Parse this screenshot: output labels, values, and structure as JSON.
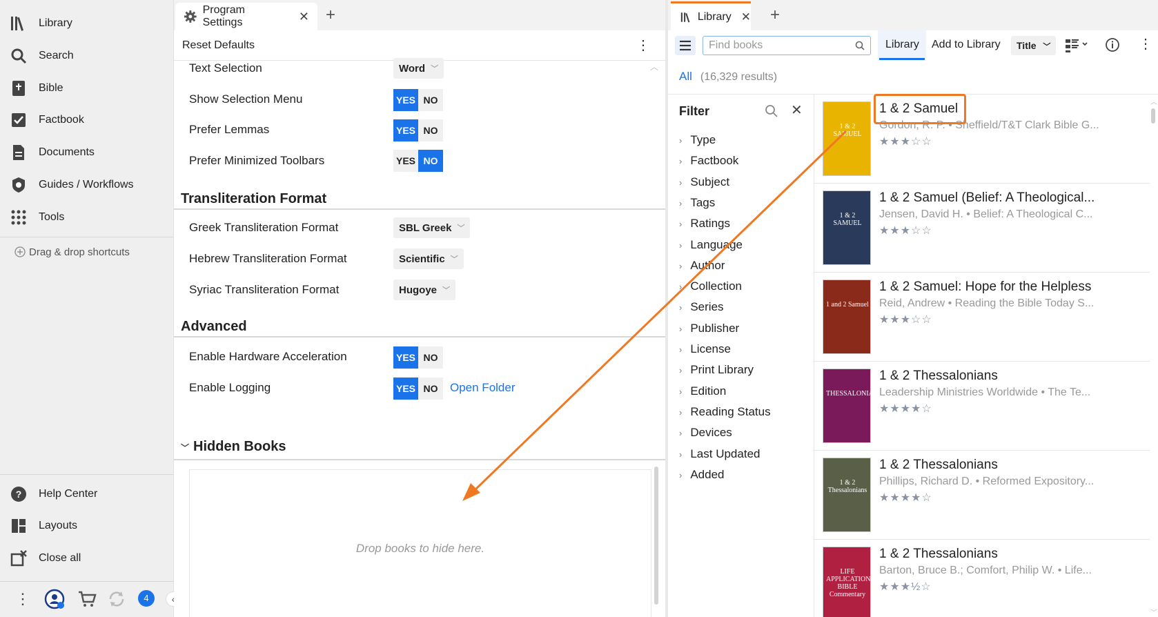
{
  "sidebar": {
    "items": [
      {
        "label": "Library",
        "icon": "library-icon"
      },
      {
        "label": "Search",
        "icon": "search-icon"
      },
      {
        "label": "Bible",
        "icon": "bible-icon"
      },
      {
        "label": "Factbook",
        "icon": "factbook-icon"
      },
      {
        "label": "Documents",
        "icon": "documents-icon"
      },
      {
        "label": "Guides / Workflows",
        "icon": "guides-icon"
      },
      {
        "label": "Tools",
        "icon": "tools-icon"
      }
    ],
    "drag_drop": "Drag & drop shortcuts",
    "bottom_items": [
      {
        "label": "Help Center",
        "icon": "help-icon"
      },
      {
        "label": "Layouts",
        "icon": "layouts-icon"
      },
      {
        "label": "Close all",
        "icon": "close-all-icon"
      }
    ],
    "notification_count": "4"
  },
  "settings": {
    "tab_title": "Program Settings",
    "reset_label": "Reset Defaults",
    "rows": {
      "text_selection": {
        "label": "Text Selection",
        "value": "Word"
      },
      "show_selection_menu": {
        "label": "Show Selection Menu"
      },
      "prefer_lemmas": {
        "label": "Prefer Lemmas"
      },
      "prefer_minimized_toolbars": {
        "label": "Prefer Minimized Toolbars"
      }
    },
    "yes": "YES",
    "no": "NO",
    "transliteration": {
      "heading": "Transliteration Format",
      "greek": {
        "label": "Greek Transliteration Format",
        "value": "SBL Greek"
      },
      "hebrew": {
        "label": "Hebrew Transliteration Format",
        "value": "Scientific"
      },
      "syriac": {
        "label": "Syriac Transliteration Format",
        "value": "Hugoye"
      }
    },
    "advanced": {
      "heading": "Advanced",
      "hardware": {
        "label": "Enable Hardware Acceleration"
      },
      "logging": {
        "label": "Enable Logging"
      },
      "open_folder": "Open Folder"
    },
    "hidden_books": {
      "heading": "Hidden Books",
      "placeholder": "Drop books to hide here."
    }
  },
  "library": {
    "tab_title": "Library",
    "search_placeholder": "Find books",
    "tab_library": "Library",
    "tab_add": "Add to Library",
    "sort": "Title",
    "results_all": "All",
    "results_count": "(16,329 results)",
    "filter_title": "Filter",
    "filters": [
      "Type",
      "Factbook",
      "Subject",
      "Tags",
      "Ratings",
      "Language",
      "Author",
      "Collection",
      "Series",
      "Publisher",
      "License",
      "Print Library",
      "Edition",
      "Reading Status",
      "Devices",
      "Last Updated",
      "Added"
    ],
    "books": [
      {
        "title": "1 & 2 Samuel",
        "author": "Gordon, R. P. • Sheffield/T&T Clark Bible G...",
        "stars": "★★★☆☆",
        "cover_color": "#e8b400",
        "cover_text": "1 & 2 SAMUEL"
      },
      {
        "title": "1 & 2 Samuel (Belief: A Theological...",
        "author": "Jensen, David H. • Belief: A Theological C...",
        "stars": "★★★☆☆",
        "cover_color": "#2a3a5a",
        "cover_text": "1 & 2 SAMUEL"
      },
      {
        "title": "1 & 2 Samuel: Hope for the Helpless",
        "author": "Reid, Andrew • Reading the Bible Today S...",
        "stars": "★★★☆☆",
        "cover_color": "#8a2a1a",
        "cover_text": "1 and 2 Samuel"
      },
      {
        "title": "1 & 2 Thessalonians",
        "author": "Leadership Ministries Worldwide • The Te...",
        "stars": "★★★★☆",
        "cover_color": "#7a1a5a",
        "cover_text": "THESSALONIANS"
      },
      {
        "title": "1 & 2 Thessalonians",
        "author": "Phillips, Richard D. • Reformed Expository...",
        "stars": "★★★★☆",
        "cover_color": "#5a6048",
        "cover_text": "1 & 2 Thessalonians"
      },
      {
        "title": "1 & 2 Thessalonians",
        "author": "Barton, Bruce B.; Comfort, Philip W. • Life...",
        "stars": "★★★½☆",
        "cover_color": "#b02040",
        "cover_text": "LIFE APPLICATION BIBLE Commentary"
      }
    ]
  },
  "colors": {
    "accent": "#1a73e8",
    "highlight": "#f07822"
  }
}
